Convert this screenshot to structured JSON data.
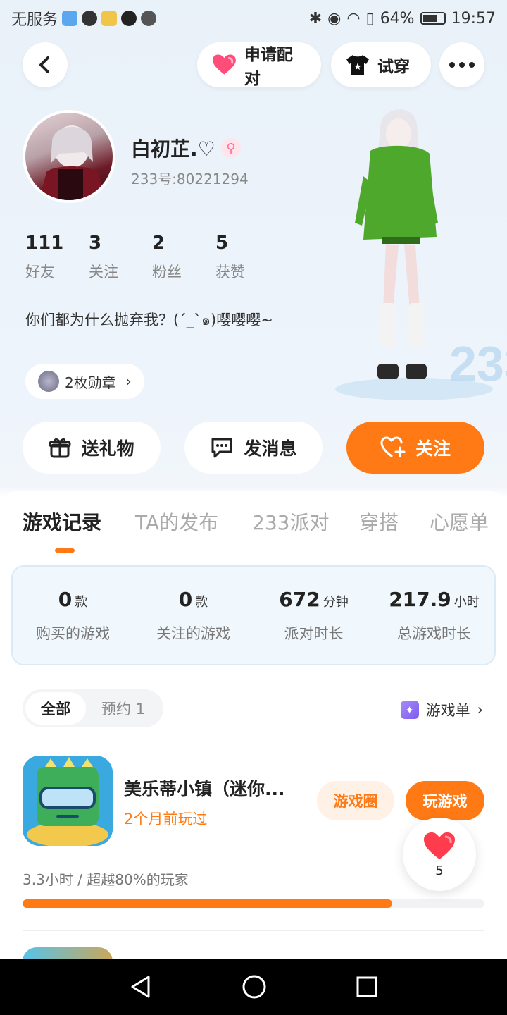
{
  "status_bar": {
    "carrier": "无服务",
    "battery": "64%",
    "time": "19:57"
  },
  "top": {
    "pair_label": "申请配对",
    "try_label": "试穿"
  },
  "profile": {
    "name": "白初芷.♡",
    "uid": "233号:80221294",
    "bio": "你们都为什么抛弃我？(ˊ_ˋ๑)嘤嘤嘤~",
    "medals": "2枚勋章"
  },
  "stats": [
    {
      "value": "111",
      "label": "好友"
    },
    {
      "value": "3",
      "label": "关注"
    },
    {
      "value": "2",
      "label": "粉丝"
    },
    {
      "value": "5",
      "label": "获赞"
    }
  ],
  "actions": {
    "gift": "送礼物",
    "message": "发消息",
    "follow": "关注"
  },
  "tabs": [
    "游戏记录",
    "TA的发布",
    "233派对",
    "穿搭",
    "心愿单"
  ],
  "game_stats": [
    {
      "value": "0",
      "unit": "款",
      "label": "购买的游戏"
    },
    {
      "value": "0",
      "unit": "款",
      "label": "关注的游戏"
    },
    {
      "value": "672",
      "unit": "分钟",
      "label": "派对时长"
    },
    {
      "value": "217.9",
      "unit": "小时",
      "label": "总游戏时长"
    }
  ],
  "filters": {
    "all": "全部",
    "reserve": "预约 1"
  },
  "game_list_label": "游戏单",
  "game": {
    "title": "美乐蒂小镇（迷你...",
    "subtitle": "2个月前玩过",
    "circle_btn": "游戏圈",
    "play_btn": "玩游戏",
    "playtime": "3.3小时 / 超越80%的玩家",
    "progress": 0.8
  },
  "likes_count": "5",
  "colors": {
    "accent": "#ff7a14",
    "pink": "#ff4d7a"
  }
}
